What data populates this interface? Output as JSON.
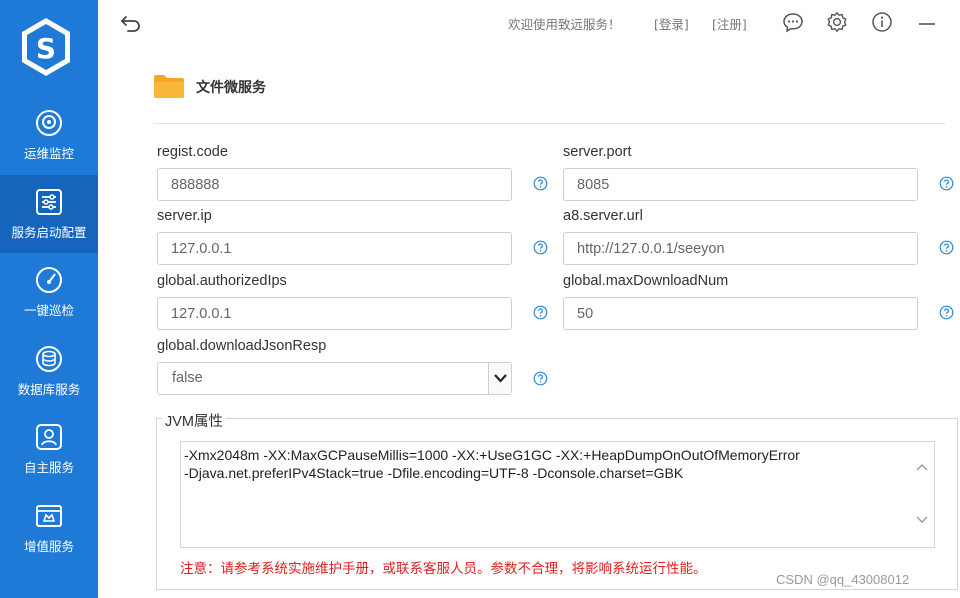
{
  "sidebar": {
    "items": [
      {
        "label": "运维监控",
        "icon": "monitor-icon"
      },
      {
        "label": "服务启动配置",
        "icon": "config-icon"
      },
      {
        "label": "一键巡检",
        "icon": "gauge-icon"
      },
      {
        "label": "数据库服务",
        "icon": "database-icon"
      },
      {
        "label": "自主服务",
        "icon": "self-service-icon"
      },
      {
        "label": "增值服务",
        "icon": "value-added-icon"
      }
    ],
    "active_index": 1,
    "colors": {
      "background": "#1e7ad6",
      "active": "#1565bd"
    }
  },
  "header": {
    "welcome": "欢迎使用致远服务！",
    "login": "[登录]",
    "register": "[注册]",
    "icons": [
      "back-icon",
      "chat-icon",
      "settings-icon",
      "info-icon",
      "minimize-icon"
    ]
  },
  "section": {
    "title": "文件微服务",
    "icon": "folder-icon"
  },
  "form": {
    "regist_code": {
      "label": "regist.code",
      "value": "888888"
    },
    "server_port": {
      "label": "server.port",
      "value": "8085"
    },
    "server_ip": {
      "label": "server.ip",
      "value": "127.0.0.1"
    },
    "a8_server_url": {
      "label": "a8.server.url",
      "value": "http://127.0.0.1/seeyon"
    },
    "authorized_ips": {
      "label": "global.authorizedIps",
      "value": "127.0.0.1"
    },
    "max_download_num": {
      "label": "global.maxDownloadNum",
      "value": "50"
    },
    "download_json_resp": {
      "label": "global.downloadJsonResp",
      "value": "false"
    }
  },
  "jvm": {
    "legend": "JVM属性",
    "value": "-Xmx2048m -XX:MaxGCPauseMillis=1000 -XX:+UseG1GC -XX:+HeapDumpOnOutOfMemoryError\n-Djava.net.preferIPv4Stack=true -Dfile.encoding=UTF-8 -Dconsole.charset=GBK",
    "warning": "注意：请参考系统实施维护手册，或联系客服人员。参数不合理，将影响系统运行性能。"
  },
  "watermark": "CSDN @qq_43008012"
}
